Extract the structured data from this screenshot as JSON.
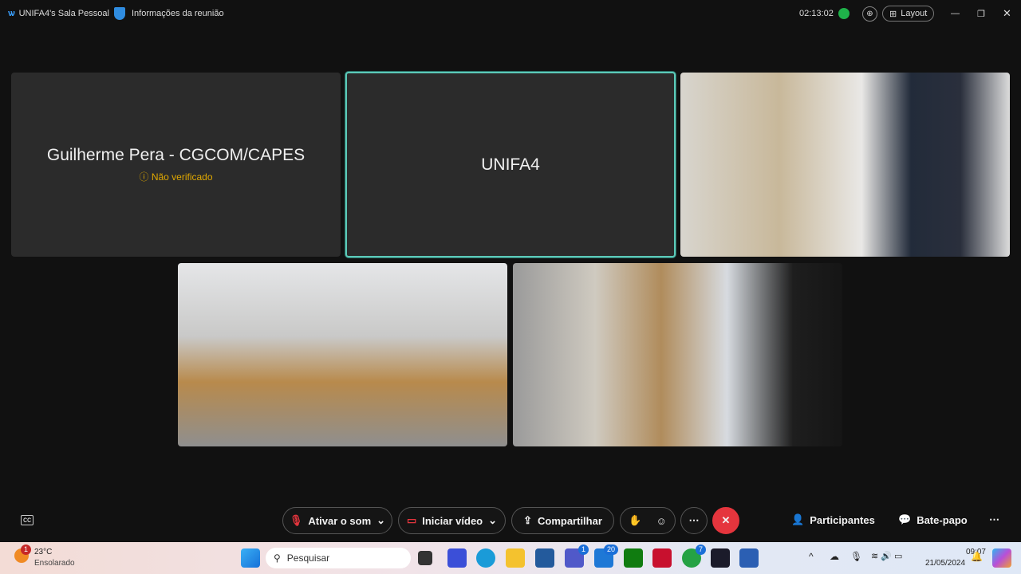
{
  "window": {
    "title": "UNIFA4's Sala Pessoal",
    "meeting_info": "Informações da reunião",
    "timer": "02:13:02",
    "layout_label": "Layout"
  },
  "participants": [
    {
      "name": "Guilherme Pera - CGCOM/CAPES",
      "status": "Não verificado"
    },
    {
      "name": "UNIFA4"
    }
  ],
  "toolbar": {
    "unmute": "Ativar o som",
    "start_video": "Iniciar vídeo",
    "share": "Compartilhar",
    "participants": "Participantes",
    "chat": "Bate-papo"
  },
  "taskbar": {
    "weather_temp": "23°C",
    "weather_desc": "Ensolarado",
    "weather_badge": "1",
    "search_placeholder": "Pesquisar",
    "teams_badge": "1",
    "app_badge": "20",
    "whatsapp_badge": "7",
    "time": "09:07",
    "date": "21/05/2024"
  },
  "colors": {
    "active_border": "#5cc9b8",
    "leave": "#e5353d"
  }
}
